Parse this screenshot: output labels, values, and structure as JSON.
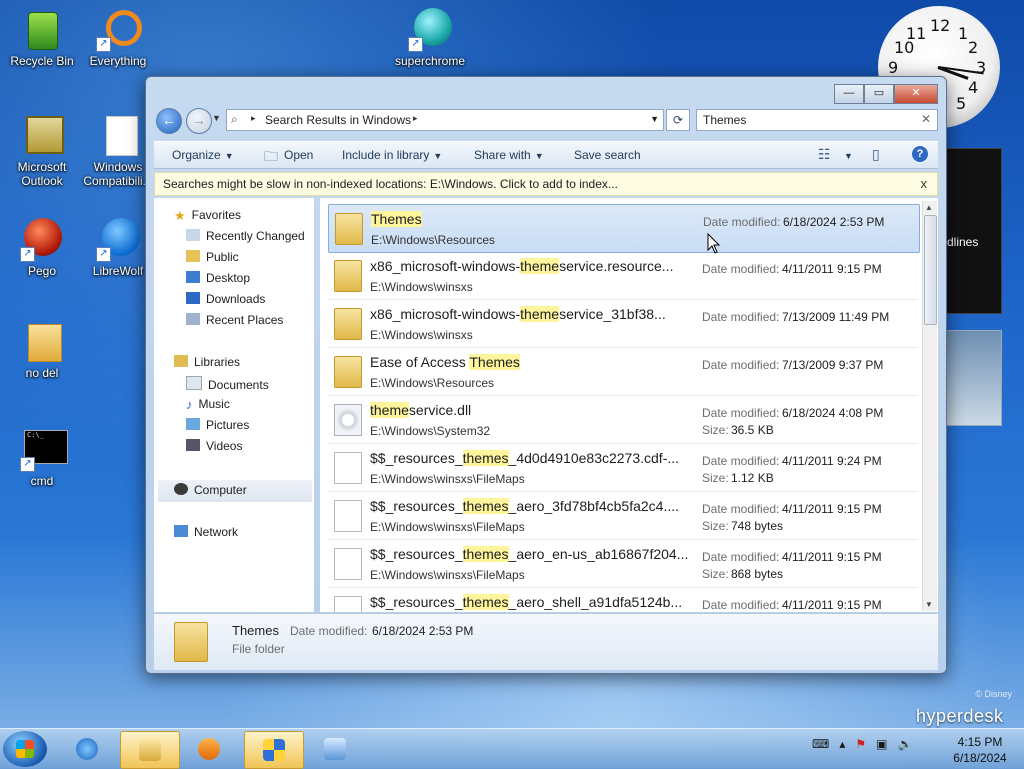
{
  "desktop": {
    "icons": [
      {
        "label": "Recycle Bin"
      },
      {
        "label": "Everything"
      },
      {
        "label": "superchrome"
      },
      {
        "label": "Microsoft Outlook"
      },
      {
        "label": "Windows Compatibili..."
      },
      {
        "label": "Pego"
      },
      {
        "label": "LibreWolf"
      },
      {
        "label": "no del"
      },
      {
        "label": "cmd"
      }
    ],
    "clock_numbers": [
      "12",
      "1",
      "2",
      "3",
      "4",
      "5",
      "9",
      "10",
      "11"
    ],
    "gadget_text": "dlines",
    "watermark_disney": "© Disney",
    "watermark_brand": "hyperdesk"
  },
  "window": {
    "caption": {
      "minimize": "—",
      "maximize": "▭",
      "close": "✕"
    },
    "address": {
      "crumb": "Search Results in Windows"
    },
    "search": {
      "query": "Themes",
      "clear": "✕"
    },
    "toolbar": {
      "organize": "Organize",
      "open": "Open",
      "include_in_library": "Include in library",
      "share_with": "Share with",
      "save_search": "Save search",
      "help": "?"
    },
    "infobar": {
      "text": "Searches might be slow in non-indexed locations: E:\\Windows. Click to add to index...",
      "close": "x"
    },
    "nav": {
      "favorites": "Favorites",
      "favorites_items": [
        "Recently Changed",
        "Public",
        "Desktop",
        "Downloads",
        "Recent Places"
      ],
      "libraries": "Libraries",
      "libraries_items": [
        "Documents",
        "Music",
        "Pictures",
        "Videos"
      ],
      "computer": "Computer",
      "network": "Network"
    },
    "labels": {
      "date_modified": "Date modified:",
      "size": "Size:"
    },
    "results": [
      {
        "pre": "",
        "hit": "Themes",
        "post": "",
        "path": "E:\\Windows\\Resources",
        "date": "6/18/2024 2:53 PM",
        "size": ""
      },
      {
        "pre": "x86_microsoft-windows-",
        "hit": "theme",
        "post": "service.resource...",
        "path": "E:\\Windows\\winsxs",
        "date": "4/11/2011 9:15 PM",
        "size": ""
      },
      {
        "pre": "x86_microsoft-windows-",
        "hit": "theme",
        "post": "service_31bf38...",
        "path": "E:\\Windows\\winsxs",
        "date": "7/13/2009 11:49 PM",
        "size": ""
      },
      {
        "pre": "Ease of Access ",
        "hit": "Themes",
        "post": "",
        "path": "E:\\Windows\\Resources",
        "date": "7/13/2009 9:37 PM",
        "size": ""
      },
      {
        "pre": "",
        "hit": "theme",
        "post": "service.dll",
        "path": "E:\\Windows\\System32",
        "date": "6/18/2024 4:08 PM",
        "size": "36.5 KB"
      },
      {
        "pre": "$$_resources_",
        "hit": "themes",
        "post": "_4d0d4910e83c2273.cdf-...",
        "path": "E:\\Windows\\winsxs\\FileMaps",
        "date": "4/11/2011 9:24 PM",
        "size": "1.12 KB"
      },
      {
        "pre": "$$_resources_",
        "hit": "themes",
        "post": "_aero_3fd78bf4cb5fa2c4....",
        "path": "E:\\Windows\\winsxs\\FileMaps",
        "date": "4/11/2011 9:15 PM",
        "size": "748 bytes"
      },
      {
        "pre": "$$_resources_",
        "hit": "themes",
        "post": "_aero_en-us_ab16867f204...",
        "path": "E:\\Windows\\winsxs\\FileMaps",
        "date": "4/11/2011 9:15 PM",
        "size": "868 bytes"
      },
      {
        "pre": "$$_resources_",
        "hit": "themes",
        "post": "_aero_shell_a91dfa5124b...",
        "path": "",
        "date": "4/11/2011 9:15 PM",
        "size": ""
      }
    ],
    "details": {
      "name": "Themes",
      "date_label": "Date modified:",
      "date": "6/18/2024 2:53 PM",
      "type": "File folder"
    }
  },
  "taskbar": {
    "time": "4:15 PM",
    "date": "6/18/2024"
  },
  "colors": {
    "highlight": "#fdf49b",
    "selection": "#c9ddf4",
    "accent": "#1f5fb8"
  }
}
